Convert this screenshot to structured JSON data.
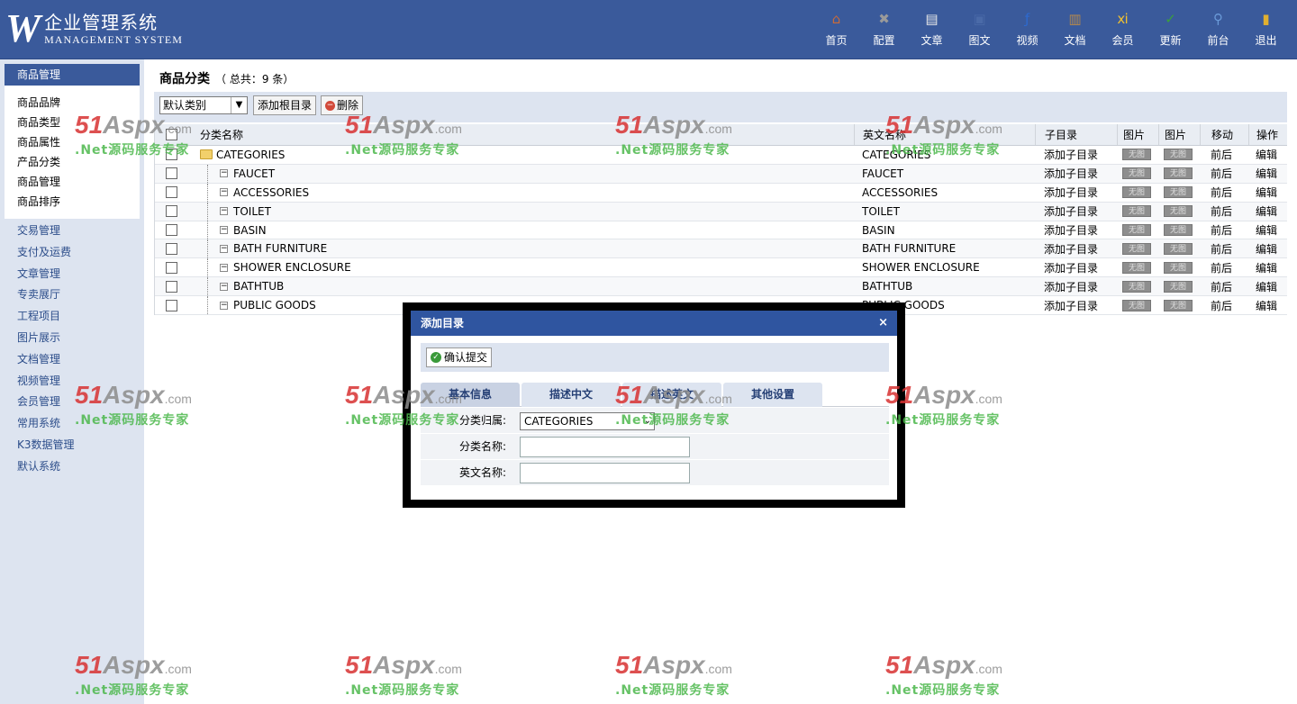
{
  "header": {
    "logo_mark": "W",
    "logo_cn": "企业管理系统",
    "logo_en": "MANAGEMENT SYSTEM",
    "nav": [
      {
        "label": "首页",
        "icon": "home-icon",
        "glyph": "⌂",
        "color": "#c86a3a"
      },
      {
        "label": "配置",
        "icon": "tools-icon",
        "glyph": "✖",
        "color": "#9a9a9a"
      },
      {
        "label": "文章",
        "icon": "article-icon",
        "glyph": "▤",
        "color": "#e8e8e8"
      },
      {
        "label": "图文",
        "icon": "image-icon",
        "glyph": "▣",
        "color": "#4a6aa8"
      },
      {
        "label": "视频",
        "icon": "video-icon",
        "glyph": "ƒ",
        "color": "#2d6ad0"
      },
      {
        "label": "文档",
        "icon": "document-icon",
        "glyph": "▥",
        "color": "#b98a4a"
      },
      {
        "label": "会员",
        "icon": "member-icon",
        "glyph": "ⅺ",
        "color": "#f0c030"
      },
      {
        "label": "更新",
        "icon": "update-icon",
        "glyph": "✓",
        "color": "#3aa03a"
      },
      {
        "label": "前台",
        "icon": "search-icon",
        "glyph": "⚲",
        "color": "#6a9ad8"
      },
      {
        "label": "退出",
        "icon": "lock-icon",
        "glyph": "▮",
        "color": "#e0b030"
      }
    ]
  },
  "sidebar": {
    "section_title": "商品管理",
    "sub_items": [
      "商品品牌",
      "商品类型",
      "商品属性",
      "产品分类",
      "商品管理",
      "商品排序"
    ],
    "main_items": [
      "交易管理",
      "支付及运费",
      "文章管理",
      "专卖展厅",
      "工程项目",
      "图片展示",
      "文档管理",
      "视频管理",
      "会员管理",
      "常用系统",
      "K3数据管理",
      "默认系统"
    ]
  },
  "content": {
    "title": "商品分类",
    "count": "（ 总共：9 条）",
    "category_select": "默认类别",
    "add_root_label": "添加根目录",
    "delete_label": "删除"
  },
  "table": {
    "headers": {
      "name": "分类名称",
      "en": "英文名称",
      "sub": "子目录",
      "img1": "图片",
      "img2": "图片",
      "move": "移动",
      "op": "操作"
    },
    "rows": [
      {
        "name": "CATEGORIES",
        "en": "CATEGORIES"
      },
      {
        "name": "FAUCET",
        "en": "FAUCET"
      },
      {
        "name": "ACCESSORIES",
        "en": "ACCESSORIES"
      },
      {
        "name": "TOILET",
        "en": "TOILET"
      },
      {
        "name": "BASIN",
        "en": "BASIN"
      },
      {
        "name": "BATH FURNITURE",
        "en": "BATH FURNITURE"
      },
      {
        "name": "SHOWER ENCLOSURE",
        "en": "SHOWER ENCLOSURE"
      },
      {
        "name": "BATHTUB",
        "en": "BATHTUB"
      },
      {
        "name": "PUBLIC GOODS",
        "en": "PUBLIC GOODS"
      }
    ],
    "add_sub_label": "添加子目录",
    "noimg_label": "无图",
    "move_label": "前后",
    "edit_label": "编辑"
  },
  "dialog": {
    "title": "添加目录",
    "close": "×",
    "confirm_label": "确认提交",
    "tabs": [
      "基本信息",
      "描述中文",
      "描述英文",
      "其他设置"
    ],
    "parent_label": "分类归属:",
    "parent_value": "CATEGORIES",
    "name_label": "分类名称:",
    "en_name_label": "英文名称:"
  },
  "watermark": {
    "num": "51",
    "brand": "Aspx",
    "dom": ".com",
    "slogan": ".Net源码服务专家"
  }
}
